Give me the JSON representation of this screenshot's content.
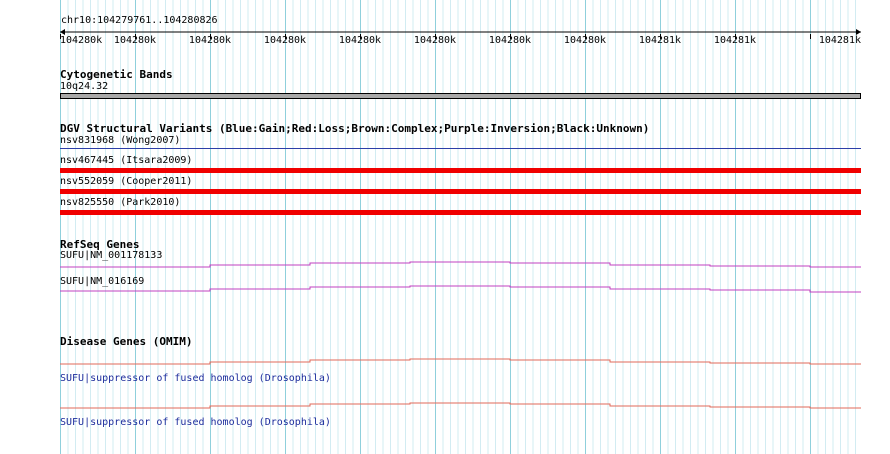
{
  "coordinates": "chr10:104279761..104280826",
  "ruler_ticks": [
    "104280k",
    "104280k",
    "104280k",
    "104280k",
    "104280k",
    "104280k",
    "104280k",
    "104280k",
    "104281k",
    "104281k",
    "104281k"
  ],
  "cytoband": {
    "title": "Cytogenetic Bands",
    "band": "10q24.32"
  },
  "dgv": {
    "title": "DGV Structural Variants (Blue:Gain;Red:Loss;Brown:Complex;Purple:Inversion;Black:Unknown)",
    "variants": [
      {
        "label": "nsv831968 (Wong2007)",
        "type": "Gain",
        "color": "#2c3ea8"
      },
      {
        "label": "nsv467445 (Itsara2009)",
        "type": "Loss",
        "color": "#f00000"
      },
      {
        "label": "nsv552059 (Cooper2011)",
        "type": "Loss",
        "color": "#f00000"
      },
      {
        "label": "nsv825550 (Park2010)",
        "type": "Loss",
        "color": "#f00000"
      }
    ]
  },
  "refseq": {
    "title": "RefSeq Genes",
    "genes": [
      {
        "label": "SUFU|NM_001178133",
        "color": "#c040c0"
      },
      {
        "label": "SUFU|NM_016169",
        "color": "#c040c0"
      }
    ]
  },
  "omim": {
    "title": "Disease Genes (OMIM)",
    "genes": [
      {
        "label": "SUFU|suppressor of fused homolog (Drosophila)",
        "color": "#e06a5a"
      },
      {
        "label": "SUFU|suppressor of fused homolog (Drosophila)",
        "color": "#e06a5a"
      }
    ]
  },
  "colors": {
    "grid_major": "#8fd0dc",
    "grid_minor": "#d2ecf2",
    "band_gray": "#a8a8a8"
  }
}
